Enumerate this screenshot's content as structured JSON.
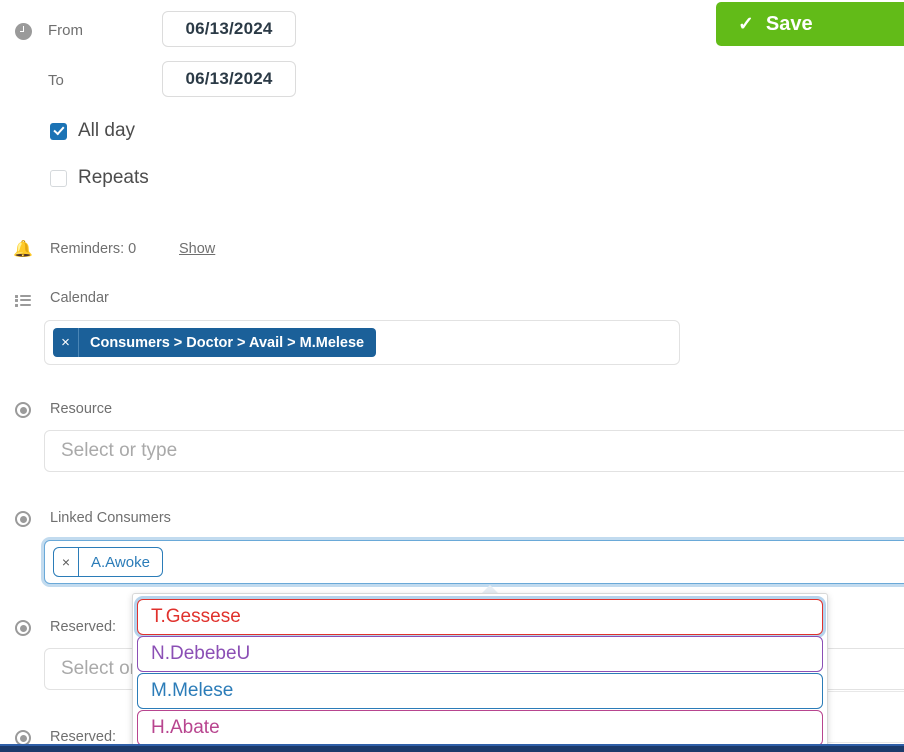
{
  "toolbar": {
    "save_label": "Save",
    "save_check_glyph": "✓",
    "save_color": "#62bb18"
  },
  "datetime": {
    "icon": "clock-icon",
    "from_label": "From",
    "from_value": "06/13/2024",
    "to_label": "To",
    "to_value": "06/13/2024",
    "all_day_label": "All day",
    "all_day_checked": true,
    "repeats_label": "Repeats",
    "repeats_checked": false
  },
  "reminders": {
    "icon": "bell-icon",
    "label": "Reminders: 0",
    "show_link": "Show"
  },
  "calendar": {
    "icon": "list-icon",
    "label": "Calendar",
    "chip": {
      "remove_glyph": "×",
      "text": "Consumers > Doctor > Avail > M.Melese",
      "color": "#1b6099"
    }
  },
  "resource": {
    "icon": "radio-icon",
    "label": "Resource",
    "placeholder": "Select or type"
  },
  "linked_consumers": {
    "icon": "radio-icon",
    "label": "Linked Consumers",
    "chip": {
      "remove_glyph": "×",
      "text": "A.Awoke",
      "color": "#2b7cb8"
    },
    "focused": true
  },
  "reserved_1": {
    "icon": "radio-icon",
    "label": "Reserved:",
    "placeholder": "Select or type"
  },
  "reserved_2": {
    "icon": "radio-icon",
    "label": "Reserved:"
  },
  "dropdown": {
    "visible": true,
    "items": [
      {
        "label": "T.Gessese",
        "color": "#e0312c",
        "active": true
      },
      {
        "label": "N.DebebeU",
        "color": "#8b4fb5",
        "active": false
      },
      {
        "label": "M.Melese",
        "color": "#2b7cb8",
        "active": false
      },
      {
        "label": "H.Abate",
        "color": "#b8458f",
        "active": false
      }
    ]
  }
}
